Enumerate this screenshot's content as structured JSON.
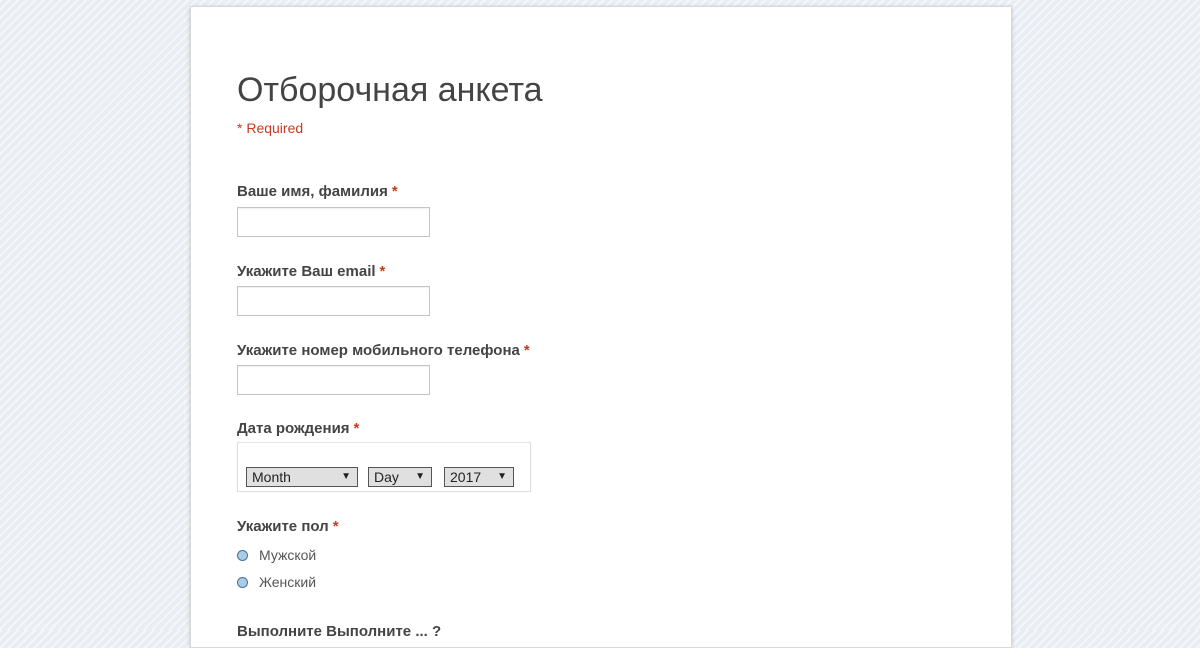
{
  "form": {
    "title": "Отборочная анкета",
    "required_note": "* Required",
    "required_mark": "*",
    "questions": {
      "name": {
        "label": "Ваше имя, фамилия",
        "value": ""
      },
      "email": {
        "label": "Укажите Ваш email",
        "value": ""
      },
      "phone": {
        "label": "Укажите номер мобильного телефона",
        "value": ""
      },
      "birthdate": {
        "label": "Дата рождения",
        "month": "Month",
        "day": "Day",
        "year": "2017"
      },
      "gender": {
        "label": "Укажите пол",
        "options": [
          "Мужской",
          "Женский"
        ]
      },
      "next_partial": "Выполните Выполните ... ?"
    }
  },
  "colors": {
    "required_red": "#c43b1d",
    "radio_fill": "#a8cde8",
    "page_bg": "#e9edf4"
  }
}
